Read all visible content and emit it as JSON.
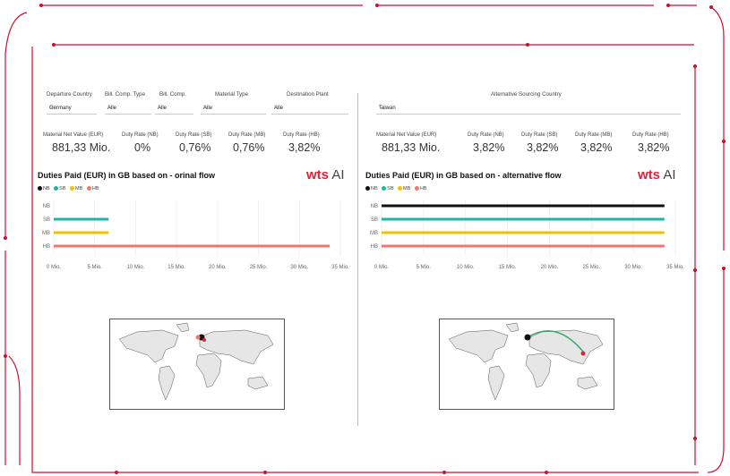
{
  "colors": {
    "accent_red": "#d6263c",
    "NB": "#111111",
    "SB": "#1fb5a6",
    "MB": "#f2c200",
    "HB": "#f2766f"
  },
  "left_panel": {
    "filters": [
      {
        "label": "Departure Country",
        "value": "Germany"
      },
      {
        "label": "Bill. Comp. Type",
        "value": "Alle"
      },
      {
        "label": "Bill. Comp.",
        "value": "Alle"
      },
      {
        "label": "Material Type",
        "value": "Alle"
      },
      {
        "label": "Destination Plant",
        "value": "Alle"
      }
    ],
    "kpis": [
      {
        "label": "Material Net Value (EUR)",
        "value": "881,33 Mio."
      },
      {
        "label": "Duty Rate (NB)",
        "value": "0%"
      },
      {
        "label": "Duty Rate (SB)",
        "value": "0,76%"
      },
      {
        "label": "Duty Rate (MB)",
        "value": "0,76%"
      },
      {
        "label": "Duty Rate (HB)",
        "value": "3,82%"
      }
    ],
    "chart_title": "Duties Paid (EUR) in GB based on - orinal flow",
    "logo": {
      "wts": "wts",
      "ai": "AI"
    },
    "legend": [
      "NB",
      "SB",
      "MB",
      "HB"
    ],
    "map_icon": "world-map-original-flow-icon"
  },
  "right_panel": {
    "filter": {
      "label": "Alternative Sourcing Country",
      "value": "Taiwan"
    },
    "kpis": [
      {
        "label": "Material Net Value (EUR)",
        "value": "881,33 Mio."
      },
      {
        "label": "Duty Rate (NB)",
        "value": "3,82%"
      },
      {
        "label": "Duty Rate (SB)",
        "value": "3,82%"
      },
      {
        "label": "Duty Rate (MB)",
        "value": "3,82%"
      },
      {
        "label": "Duty Rate (HB)",
        "value": "3,82%"
      }
    ],
    "chart_title": "Duties Paid (EUR) in GB based on - alternative flow",
    "logo": {
      "wts": "wts",
      "ai": "AI"
    },
    "legend": [
      "NB",
      "SB",
      "MB",
      "HB"
    ],
    "map_icon": "world-map-alternative-flow-icon"
  },
  "chart_data": [
    {
      "type": "bar",
      "orientation": "horizontal",
      "title": "Duties Paid (EUR) in GB based on - orinal flow",
      "categories": [
        "NB",
        "SB",
        "MB",
        "HB"
      ],
      "values": [
        0,
        6.7,
        6.7,
        33.7
      ],
      "xlim": [
        0,
        35
      ],
      "xticks": [
        "0 Mio.",
        "5 Mio.",
        "10 Mio.",
        "15 Mio.",
        "20 Mio.",
        "25 Mio.",
        "30 Mio.",
        "35 Mio."
      ],
      "legend": [
        "NB",
        "SB",
        "MB",
        "HB"
      ],
      "legend_position": "top-left",
      "grid": true
    },
    {
      "type": "bar",
      "orientation": "horizontal",
      "title": "Duties Paid (EUR) in GB based on - alternative flow",
      "categories": [
        "NB",
        "SB",
        "MB",
        "HB"
      ],
      "values": [
        33.7,
        33.7,
        33.7,
        33.7
      ],
      "xlim": [
        0,
        35
      ],
      "xticks": [
        "0 Mio.",
        "5 Mio.",
        "10 Mio.",
        "15 Mio.",
        "20 Mio.",
        "25 Mio.",
        "30 Mio.",
        "35 Mio."
      ],
      "legend": [
        "NB",
        "SB",
        "MB",
        "HB"
      ],
      "legend_position": "top-left",
      "grid": true
    }
  ]
}
